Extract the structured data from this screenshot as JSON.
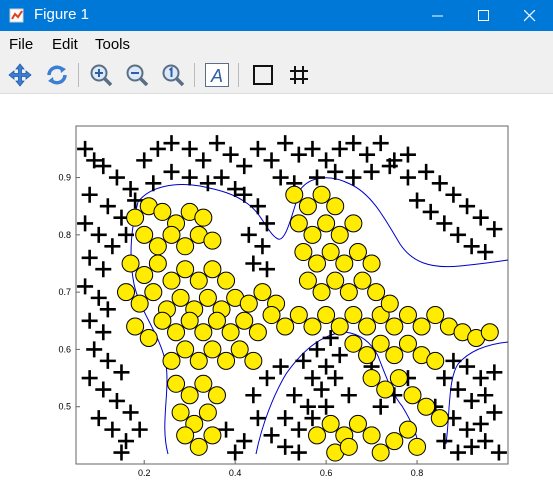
{
  "window": {
    "title": "Figure 1"
  },
  "menu": [
    "File",
    "Edit",
    "Tools"
  ],
  "toolbar": {
    "icons": [
      "pan-icon",
      "rotate-icon",
      "zoom-in-icon",
      "zoom-out-icon",
      "zoom-reset-icon",
      "text-icon",
      "rectangle-icon",
      "grid-icon"
    ]
  },
  "colors": {
    "titlebar": "#0078d7",
    "marker_fill": "#ffec00",
    "boundary": "#0000cc"
  },
  "chart_data": {
    "type": "scatter",
    "title": "",
    "xlabel": "",
    "ylabel": "",
    "xlim": [
      0.05,
      1.0
    ],
    "ylim": [
      0.4,
      0.99
    ],
    "xticks": [
      "0.2",
      "0.4",
      "0.6",
      "0.8"
    ],
    "yticks": [
      "0.5",
      "0.6",
      "0.7",
      "0.8",
      "0.9"
    ],
    "series": [
      {
        "marker": "plus",
        "color": "#000000",
        "points": [
          [
            0.07,
            0.95
          ],
          [
            0.09,
            0.93
          ],
          [
            0.11,
            0.92
          ],
          [
            0.14,
            0.9
          ],
          [
            0.17,
            0.88
          ],
          [
            0.08,
            0.87
          ],
          [
            0.12,
            0.85
          ],
          [
            0.15,
            0.83
          ],
          [
            0.07,
            0.82
          ],
          [
            0.1,
            0.8
          ],
          [
            0.13,
            0.78
          ],
          [
            0.08,
            0.76
          ],
          [
            0.11,
            0.74
          ],
          [
            0.07,
            0.71
          ],
          [
            0.1,
            0.69
          ],
          [
            0.12,
            0.67
          ],
          [
            0.08,
            0.65
          ],
          [
            0.11,
            0.63
          ],
          [
            0.09,
            0.6
          ],
          [
            0.12,
            0.58
          ],
          [
            0.15,
            0.56
          ],
          [
            0.08,
            0.55
          ],
          [
            0.11,
            0.53
          ],
          [
            0.14,
            0.51
          ],
          [
            0.17,
            0.49
          ],
          [
            0.1,
            0.48
          ],
          [
            0.13,
            0.46
          ],
          [
            0.16,
            0.44
          ],
          [
            0.19,
            0.46
          ],
          [
            0.15,
            0.42
          ],
          [
            0.2,
            0.93
          ],
          [
            0.23,
            0.95
          ],
          [
            0.26,
            0.96
          ],
          [
            0.3,
            0.95
          ],
          [
            0.33,
            0.93
          ],
          [
            0.36,
            0.96
          ],
          [
            0.39,
            0.94
          ],
          [
            0.42,
            0.92
          ],
          [
            0.45,
            0.95
          ],
          [
            0.48,
            0.93
          ],
          [
            0.51,
            0.96
          ],
          [
            0.54,
            0.94
          ],
          [
            0.57,
            0.95
          ],
          [
            0.6,
            0.93
          ],
          [
            0.63,
            0.95
          ],
          [
            0.66,
            0.96
          ],
          [
            0.69,
            0.94
          ],
          [
            0.72,
            0.96
          ],
          [
            0.75,
            0.93
          ],
          [
            0.78,
            0.94
          ],
          [
            0.82,
            0.91
          ],
          [
            0.85,
            0.89
          ],
          [
            0.88,
            0.87
          ],
          [
            0.91,
            0.85
          ],
          [
            0.94,
            0.83
          ],
          [
            0.97,
            0.81
          ],
          [
            0.8,
            0.86
          ],
          [
            0.83,
            0.84
          ],
          [
            0.86,
            0.82
          ],
          [
            0.89,
            0.8
          ],
          [
            0.92,
            0.78
          ],
          [
            0.95,
            0.77
          ],
          [
            0.42,
            0.87
          ],
          [
            0.45,
            0.85
          ],
          [
            0.47,
            0.82
          ],
          [
            0.43,
            0.8
          ],
          [
            0.46,
            0.78
          ],
          [
            0.44,
            0.75
          ],
          [
            0.47,
            0.74
          ],
          [
            0.4,
            0.88
          ],
          [
            0.37,
            0.9
          ],
          [
            0.34,
            0.89
          ],
          [
            0.3,
            0.9
          ],
          [
            0.26,
            0.91
          ],
          [
            0.22,
            0.89
          ],
          [
            0.18,
            0.86
          ],
          [
            0.16,
            0.8
          ],
          [
            0.78,
            0.9
          ],
          [
            0.74,
            0.92
          ],
          [
            0.7,
            0.91
          ],
          [
            0.66,
            0.9
          ],
          [
            0.62,
            0.91
          ],
          [
            0.58,
            0.9
          ],
          [
            0.53,
            0.89
          ],
          [
            0.5,
            0.9
          ],
          [
            0.55,
            0.58
          ],
          [
            0.58,
            0.6
          ],
          [
            0.61,
            0.62
          ],
          [
            0.57,
            0.55
          ],
          [
            0.6,
            0.57
          ],
          [
            0.63,
            0.59
          ],
          [
            0.53,
            0.52
          ],
          [
            0.56,
            0.5
          ],
          [
            0.59,
            0.53
          ],
          [
            0.62,
            0.55
          ],
          [
            0.51,
            0.48
          ],
          [
            0.54,
            0.46
          ],
          [
            0.57,
            0.48
          ],
          [
            0.6,
            0.5
          ],
          [
            0.65,
            0.52
          ],
          [
            0.48,
            0.45
          ],
          [
            0.51,
            0.43
          ],
          [
            0.54,
            0.42
          ],
          [
            0.45,
            0.48
          ],
          [
            0.42,
            0.44
          ],
          [
            0.4,
            0.42
          ],
          [
            0.38,
            0.46
          ],
          [
            0.44,
            0.52
          ],
          [
            0.47,
            0.55
          ],
          [
            0.5,
            0.57
          ],
          [
            0.88,
            0.58
          ],
          [
            0.91,
            0.57
          ],
          [
            0.94,
            0.55
          ],
          [
            0.97,
            0.56
          ],
          [
            0.89,
            0.53
          ],
          [
            0.92,
            0.51
          ],
          [
            0.95,
            0.52
          ],
          [
            0.88,
            0.48
          ],
          [
            0.91,
            0.46
          ],
          [
            0.94,
            0.47
          ],
          [
            0.97,
            0.49
          ],
          [
            0.86,
            0.44
          ],
          [
            0.89,
            0.42
          ],
          [
            0.92,
            0.43
          ],
          [
            0.95,
            0.44
          ],
          [
            0.98,
            0.42
          ],
          [
            0.84,
            0.5
          ],
          [
            0.86,
            0.55
          ],
          [
            0.75,
            0.52
          ],
          [
            0.78,
            0.55
          ],
          [
            0.72,
            0.5
          ],
          [
            0.7,
            0.57
          ]
        ]
      },
      {
        "marker": "circle",
        "color": "#ffec00",
        "points": [
          [
            0.18,
            0.83
          ],
          [
            0.21,
            0.85
          ],
          [
            0.24,
            0.84
          ],
          [
            0.27,
            0.82
          ],
          [
            0.3,
            0.84
          ],
          [
            0.33,
            0.83
          ],
          [
            0.2,
            0.8
          ],
          [
            0.23,
            0.78
          ],
          [
            0.26,
            0.8
          ],
          [
            0.29,
            0.78
          ],
          [
            0.32,
            0.8
          ],
          [
            0.35,
            0.79
          ],
          [
            0.17,
            0.75
          ],
          [
            0.2,
            0.73
          ],
          [
            0.23,
            0.75
          ],
          [
            0.26,
            0.72
          ],
          [
            0.29,
            0.74
          ],
          [
            0.32,
            0.72
          ],
          [
            0.35,
            0.74
          ],
          [
            0.38,
            0.72
          ],
          [
            0.16,
            0.7
          ],
          [
            0.19,
            0.68
          ],
          [
            0.22,
            0.7
          ],
          [
            0.25,
            0.67
          ],
          [
            0.28,
            0.69
          ],
          [
            0.31,
            0.67
          ],
          [
            0.34,
            0.69
          ],
          [
            0.37,
            0.67
          ],
          [
            0.4,
            0.69
          ],
          [
            0.43,
            0.68
          ],
          [
            0.46,
            0.7
          ],
          [
            0.49,
            0.68
          ],
          [
            0.18,
            0.64
          ],
          [
            0.21,
            0.62
          ],
          [
            0.24,
            0.65
          ],
          [
            0.27,
            0.63
          ],
          [
            0.3,
            0.65
          ],
          [
            0.33,
            0.63
          ],
          [
            0.36,
            0.65
          ],
          [
            0.39,
            0.63
          ],
          [
            0.42,
            0.65
          ],
          [
            0.45,
            0.63
          ],
          [
            0.48,
            0.66
          ],
          [
            0.51,
            0.64
          ],
          [
            0.54,
            0.66
          ],
          [
            0.57,
            0.64
          ],
          [
            0.6,
            0.66
          ],
          [
            0.63,
            0.64
          ],
          [
            0.66,
            0.66
          ],
          [
            0.69,
            0.64
          ],
          [
            0.72,
            0.66
          ],
          [
            0.75,
            0.64
          ],
          [
            0.78,
            0.66
          ],
          [
            0.81,
            0.64
          ],
          [
            0.84,
            0.66
          ],
          [
            0.87,
            0.64
          ],
          [
            0.9,
            0.63
          ],
          [
            0.93,
            0.62
          ],
          [
            0.96,
            0.63
          ],
          [
            0.26,
            0.58
          ],
          [
            0.29,
            0.6
          ],
          [
            0.32,
            0.58
          ],
          [
            0.35,
            0.6
          ],
          [
            0.38,
            0.58
          ],
          [
            0.41,
            0.6
          ],
          [
            0.44,
            0.58
          ],
          [
            0.27,
            0.54
          ],
          [
            0.3,
            0.52
          ],
          [
            0.33,
            0.54
          ],
          [
            0.36,
            0.52
          ],
          [
            0.28,
            0.49
          ],
          [
            0.31,
            0.47
          ],
          [
            0.34,
            0.49
          ],
          [
            0.29,
            0.45
          ],
          [
            0.32,
            0.43
          ],
          [
            0.35,
            0.45
          ],
          [
            0.53,
            0.87
          ],
          [
            0.56,
            0.85
          ],
          [
            0.59,
            0.87
          ],
          [
            0.62,
            0.85
          ],
          [
            0.54,
            0.82
          ],
          [
            0.57,
            0.8
          ],
          [
            0.6,
            0.82
          ],
          [
            0.63,
            0.8
          ],
          [
            0.66,
            0.82
          ],
          [
            0.55,
            0.77
          ],
          [
            0.58,
            0.75
          ],
          [
            0.61,
            0.77
          ],
          [
            0.64,
            0.75
          ],
          [
            0.67,
            0.77
          ],
          [
            0.7,
            0.75
          ],
          [
            0.56,
            0.72
          ],
          [
            0.59,
            0.7
          ],
          [
            0.62,
            0.72
          ],
          [
            0.65,
            0.7
          ],
          [
            0.68,
            0.72
          ],
          [
            0.71,
            0.7
          ],
          [
            0.74,
            0.68
          ],
          [
            0.66,
            0.61
          ],
          [
            0.69,
            0.59
          ],
          [
            0.72,
            0.61
          ],
          [
            0.75,
            0.59
          ],
          [
            0.78,
            0.61
          ],
          [
            0.81,
            0.59
          ],
          [
            0.84,
            0.58
          ],
          [
            0.7,
            0.55
          ],
          [
            0.73,
            0.53
          ],
          [
            0.76,
            0.55
          ],
          [
            0.79,
            0.52
          ],
          [
            0.82,
            0.5
          ],
          [
            0.85,
            0.48
          ],
          [
            0.58,
            0.45
          ],
          [
            0.61,
            0.47
          ],
          [
            0.64,
            0.45
          ],
          [
            0.67,
            0.47
          ],
          [
            0.7,
            0.45
          ],
          [
            0.62,
            0.42
          ],
          [
            0.65,
            0.43
          ],
          [
            0.72,
            0.42
          ],
          [
            0.75,
            0.44
          ],
          [
            0.78,
            0.46
          ],
          [
            0.8,
            0.43
          ]
        ]
      }
    ]
  }
}
